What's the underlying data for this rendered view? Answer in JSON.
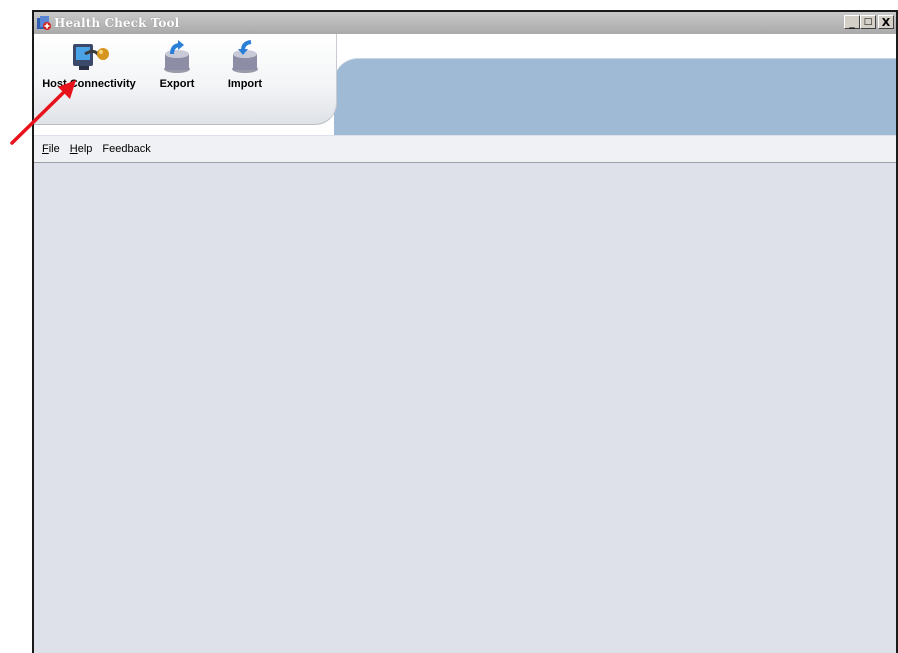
{
  "window": {
    "title": "Health Check Tool",
    "controls": {
      "minimize": "_",
      "restore": "□",
      "close": "X"
    }
  },
  "toolbar": {
    "items": [
      {
        "label": "Host Connectivity",
        "icon": "host-connectivity-icon"
      },
      {
        "label": "Export",
        "icon": "export-icon"
      },
      {
        "label": "Import",
        "icon": "import-icon"
      }
    ]
  },
  "menu": {
    "items": [
      {
        "mnemonic": "F",
        "rest": "ile"
      },
      {
        "mnemonic": "H",
        "rest": "elp"
      },
      {
        "mnemonic": "",
        "rest": "Feedback"
      }
    ]
  },
  "annotation": {
    "icon": "red-arrow-annotation",
    "color": "#e8121b"
  },
  "colors": {
    "content_bg": "#dfe1ea",
    "band_blue": "#9fbad5",
    "titlebar": "#b0b0b0"
  }
}
